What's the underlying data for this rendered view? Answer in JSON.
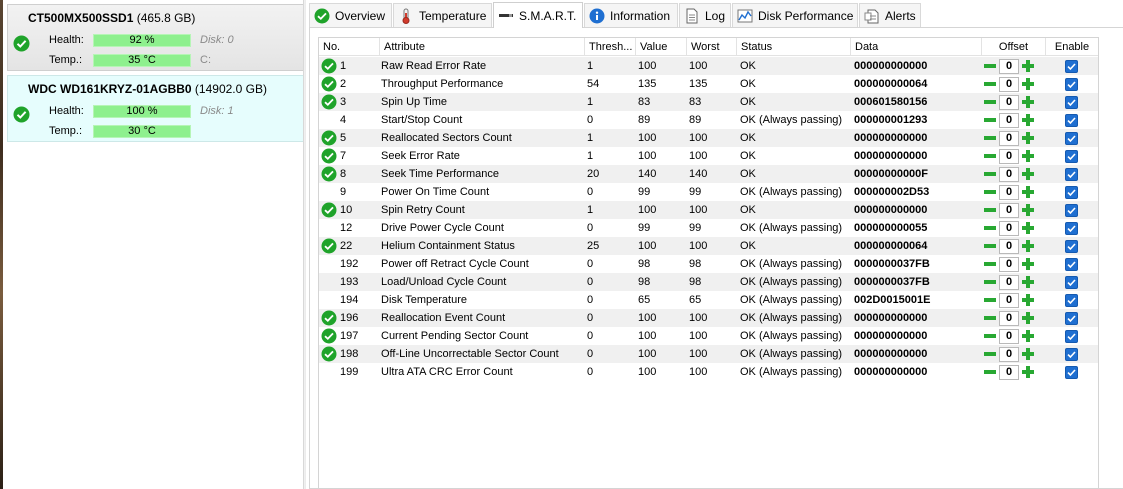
{
  "drives": [
    {
      "model": "CT500MX500SSD1",
      "size": "(465.8 GB)",
      "health_label": "Health:",
      "health": "92 %",
      "disk_label": "Disk: 0",
      "temp_label": "Temp.:",
      "temp": "35 °C",
      "letter": "C:"
    },
    {
      "model": "WDC WD161KRYZ-01AGBB0",
      "size": "(14902.0 GB)",
      "health_label": "Health:",
      "health": "100 %",
      "disk_label": "Disk: 1",
      "temp_label": "Temp.:",
      "temp": "30 °C",
      "letter": ""
    }
  ],
  "tabs": [
    {
      "label": "Overview",
      "icon": "check-icon"
    },
    {
      "label": "Temperature",
      "icon": "thermometer-icon"
    },
    {
      "label": "S.M.A.R.T.",
      "icon": "smart-icon"
    },
    {
      "label": "Information",
      "icon": "info-icon"
    },
    {
      "label": "Log",
      "icon": "document-icon"
    },
    {
      "label": "Disk Performance",
      "icon": "performance-icon"
    },
    {
      "label": "Alerts",
      "icon": "alerts-icon"
    }
  ],
  "active_tab": "S.M.A.R.T.",
  "columns": [
    "No.",
    "Attribute",
    "Thresh...",
    "Value",
    "Worst",
    "Status",
    "Data",
    "Offset",
    "Enable"
  ],
  "rows": [
    {
      "no": "1",
      "attr": "Raw Read Error Rate",
      "thresh": "1",
      "value": "100",
      "worst": "100",
      "status": "OK",
      "data": "000000000000",
      "offset": "0",
      "ok_icon": true
    },
    {
      "no": "2",
      "attr": "Throughput Performance",
      "thresh": "54",
      "value": "135",
      "worst": "135",
      "status": "OK",
      "data": "000000000064",
      "offset": "0",
      "ok_icon": true
    },
    {
      "no": "3",
      "attr": "Spin Up Time",
      "thresh": "1",
      "value": "83",
      "worst": "83",
      "status": "OK",
      "data": "000601580156",
      "offset": "0",
      "ok_icon": true
    },
    {
      "no": "4",
      "attr": "Start/Stop Count",
      "thresh": "0",
      "value": "89",
      "worst": "89",
      "status": "OK (Always passing)",
      "data": "000000001293",
      "offset": "0",
      "ok_icon": false
    },
    {
      "no": "5",
      "attr": "Reallocated Sectors Count",
      "thresh": "1",
      "value": "100",
      "worst": "100",
      "status": "OK",
      "data": "000000000000",
      "offset": "0",
      "ok_icon": true
    },
    {
      "no": "7",
      "attr": "Seek Error Rate",
      "thresh": "1",
      "value": "100",
      "worst": "100",
      "status": "OK",
      "data": "000000000000",
      "offset": "0",
      "ok_icon": true
    },
    {
      "no": "8",
      "attr": "Seek Time Performance",
      "thresh": "20",
      "value": "140",
      "worst": "140",
      "status": "OK",
      "data": "00000000000F",
      "offset": "0",
      "ok_icon": true
    },
    {
      "no": "9",
      "attr": "Power On Time Count",
      "thresh": "0",
      "value": "99",
      "worst": "99",
      "status": "OK (Always passing)",
      "data": "000000002D53",
      "offset": "0",
      "ok_icon": false
    },
    {
      "no": "10",
      "attr": "Spin Retry Count",
      "thresh": "1",
      "value": "100",
      "worst": "100",
      "status": "OK",
      "data": "000000000000",
      "offset": "0",
      "ok_icon": true
    },
    {
      "no": "12",
      "attr": "Drive Power Cycle Count",
      "thresh": "0",
      "value": "99",
      "worst": "99",
      "status": "OK (Always passing)",
      "data": "000000000055",
      "offset": "0",
      "ok_icon": false
    },
    {
      "no": "22",
      "attr": "Helium Containment Status",
      "thresh": "25",
      "value": "100",
      "worst": "100",
      "status": "OK",
      "data": "000000000064",
      "offset": "0",
      "ok_icon": true
    },
    {
      "no": "192",
      "attr": "Power off Retract Cycle Count",
      "thresh": "0",
      "value": "98",
      "worst": "98",
      "status": "OK (Always passing)",
      "data": "0000000037FB",
      "offset": "0",
      "ok_icon": false
    },
    {
      "no": "193",
      "attr": "Load/Unload Cycle Count",
      "thresh": "0",
      "value": "98",
      "worst": "98",
      "status": "OK (Always passing)",
      "data": "0000000037FB",
      "offset": "0",
      "ok_icon": false
    },
    {
      "no": "194",
      "attr": "Disk Temperature",
      "thresh": "0",
      "value": "65",
      "worst": "65",
      "status": "OK (Always passing)",
      "data": "002D0015001E",
      "offset": "0",
      "ok_icon": false
    },
    {
      "no": "196",
      "attr": "Reallocation Event Count",
      "thresh": "0",
      "value": "100",
      "worst": "100",
      "status": "OK (Always passing)",
      "data": "000000000000",
      "offset": "0",
      "ok_icon": true
    },
    {
      "no": "197",
      "attr": "Current Pending Sector Count",
      "thresh": "0",
      "value": "100",
      "worst": "100",
      "status": "OK (Always passing)",
      "data": "000000000000",
      "offset": "0",
      "ok_icon": true
    },
    {
      "no": "198",
      "attr": "Off-Line Uncorrectable Sector Count",
      "thresh": "0",
      "value": "100",
      "worst": "100",
      "status": "OK (Always passing)",
      "data": "000000000000",
      "offset": "0",
      "ok_icon": true
    },
    {
      "no": "199",
      "attr": "Ultra ATA CRC Error Count",
      "thresh": "0",
      "value": "100",
      "worst": "100",
      "status": "OK (Always passing)",
      "data": "000000000000",
      "offset": "0",
      "ok_icon": false
    }
  ],
  "colors": {
    "ok_green": "#1fa32a",
    "bar_green": "#8ef08e",
    "checkbox_blue": "#1f6fd1",
    "selected_drive": "#e6fdfd"
  }
}
